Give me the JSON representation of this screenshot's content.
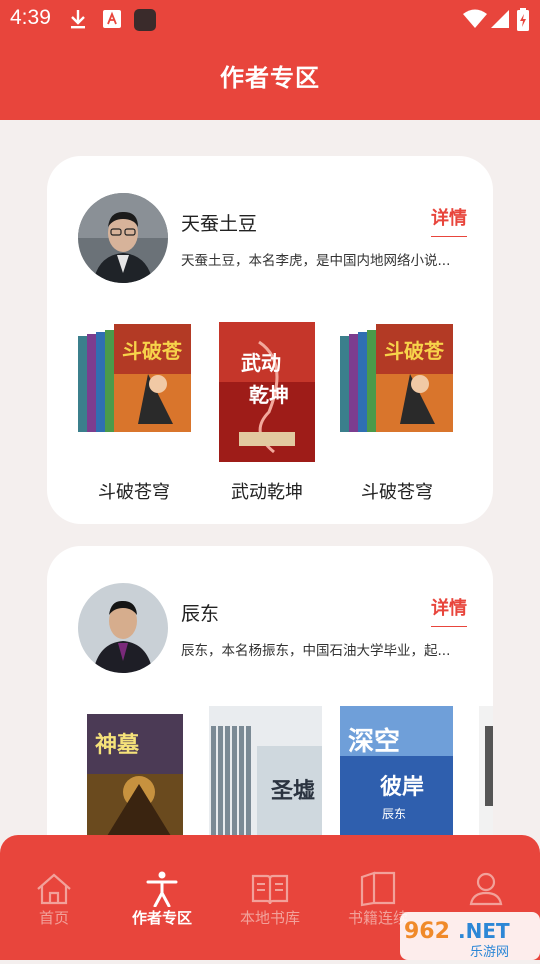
{
  "status": {
    "time": "4:39"
  },
  "header": {
    "title": "作者专区"
  },
  "authors": [
    {
      "name": "天蚕土豆",
      "description": "天蚕土豆，本名李虎，是中国内地网络小说...",
      "detail_label": "详情",
      "books": [
        "斗破苍穹",
        "武动乾坤",
        "斗破苍穹"
      ]
    },
    {
      "name": "辰东",
      "description": "辰东，本名杨振东，中国石油大学毕业，起...",
      "detail_label": "详情",
      "books": []
    }
  ],
  "nav": {
    "items": [
      {
        "label": "首页",
        "icon": "home-icon"
      },
      {
        "label": "作者专区",
        "icon": "person-icon"
      },
      {
        "label": "本地书库",
        "icon": "book-open-icon"
      },
      {
        "label": "书籍连续",
        "icon": "book-icon"
      },
      {
        "label": "",
        "icon": "user-icon"
      }
    ]
  },
  "watermark": {
    "text1": "962",
    "text2": ".NET",
    "text3": "乐游网"
  },
  "colors": {
    "accent": "#e8453c",
    "background": "#f4efee"
  }
}
